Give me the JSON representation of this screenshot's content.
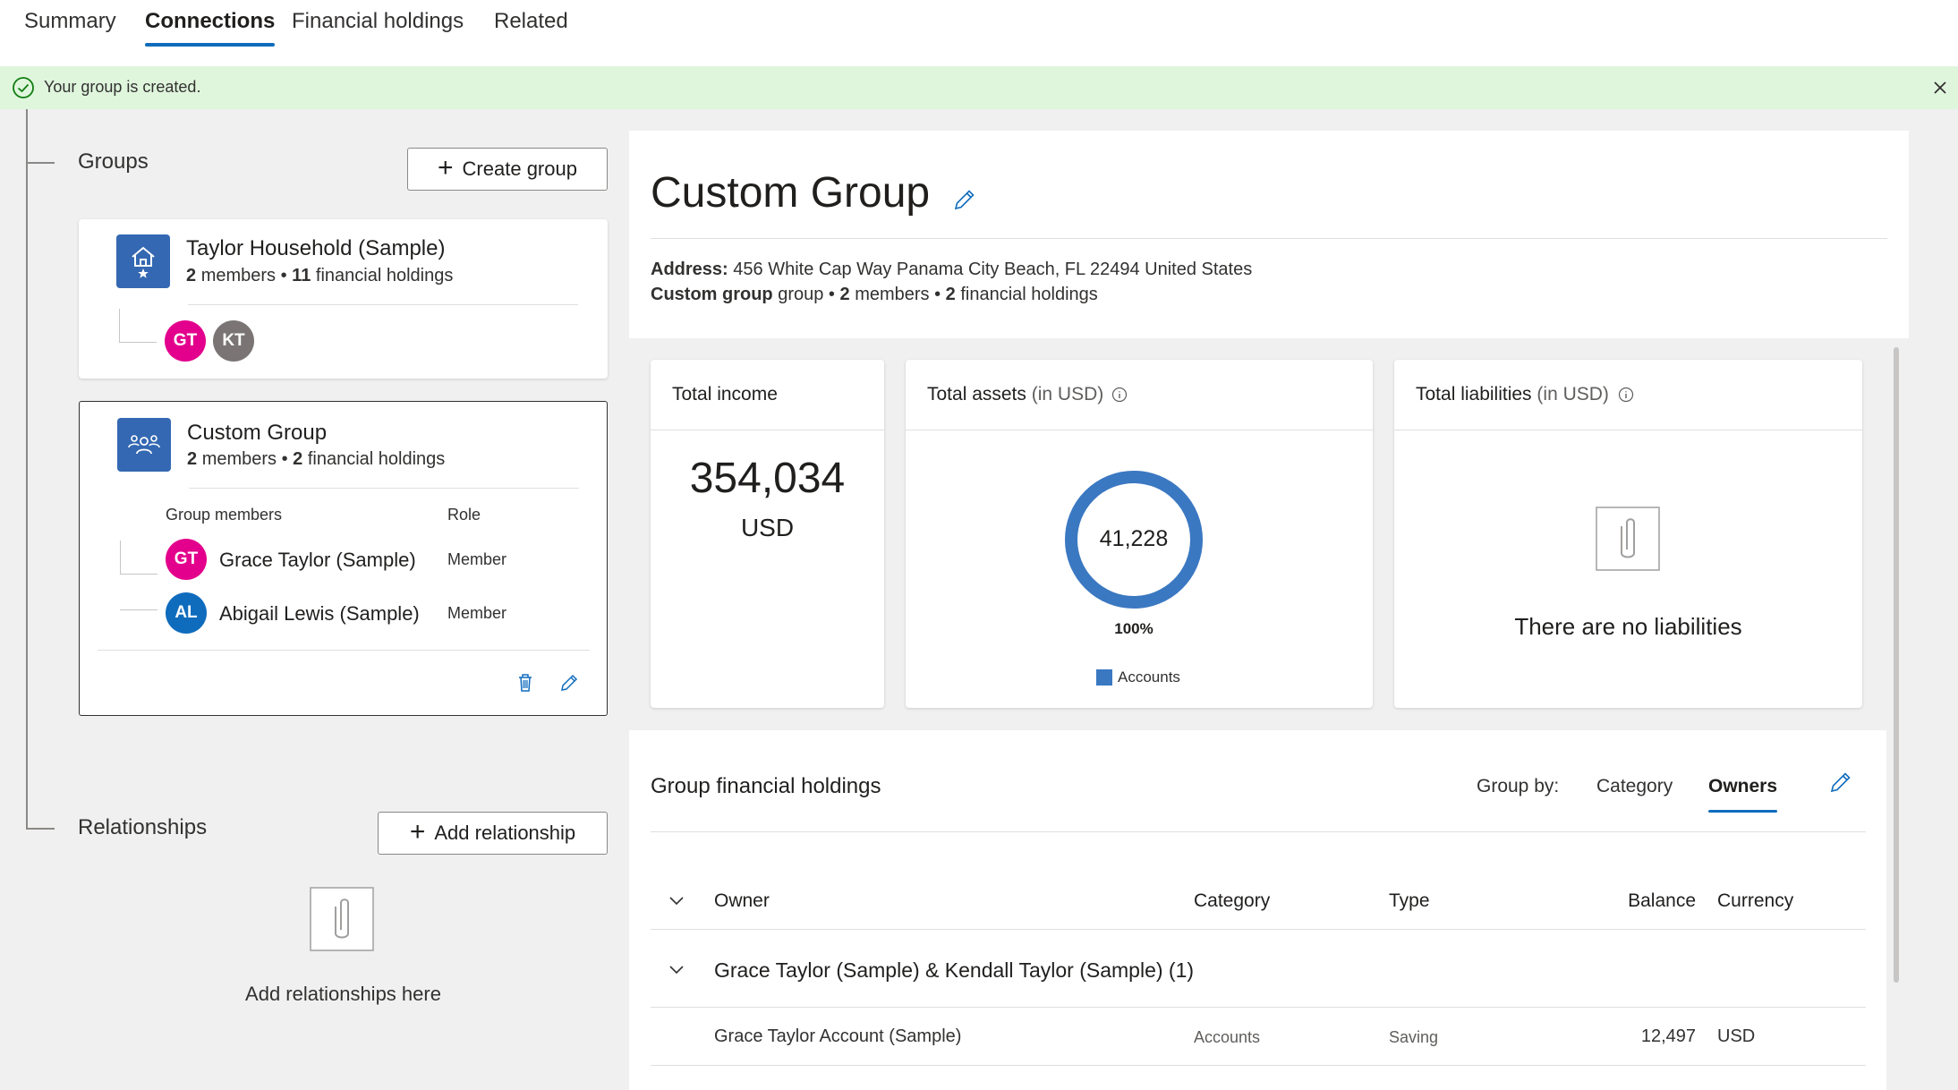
{
  "tabs": [
    {
      "label": "Summary",
      "active": false
    },
    {
      "label": "Connections",
      "active": true
    },
    {
      "label": "Financial holdings",
      "active": false
    },
    {
      "label": "Related",
      "active": false
    }
  ],
  "notification": {
    "text": "Your group is created.",
    "status_color": "#107c10"
  },
  "groups": {
    "title": "Groups",
    "create_label": "Create group",
    "household": {
      "name": "Taylor Household (Sample)",
      "members_count": "2",
      "members_word": "members",
      "holdings_count": "11",
      "holdings_word": "financial holdings",
      "avatars": [
        {
          "initials": "GT",
          "color": "#e3008c"
        },
        {
          "initials": "KT",
          "color": "#7a7574"
        }
      ]
    },
    "custom": {
      "name": "Custom Group",
      "members_count": "2",
      "members_word": "members",
      "holdings_count": "2",
      "holdings_word": "financial holdings",
      "members_header": "Group members",
      "role_header": "Role",
      "members": [
        {
          "initials": "GT",
          "color": "#e3008c",
          "name": "Grace Taylor (Sample)",
          "role": "Member"
        },
        {
          "initials": "AL",
          "color": "#0f6cbd",
          "name": "Abigail Lewis (Sample)",
          "role": "Member"
        }
      ]
    }
  },
  "relationships": {
    "title": "Relationships",
    "add_label": "Add relationship",
    "empty_text": "Add relationships here"
  },
  "detail": {
    "title": "Custom Group",
    "address_label": "Address:",
    "address_value": "456 White Cap Way Panama City Beach, FL 22494 United States",
    "type_bold": "Custom group",
    "type_word": "group",
    "members_count": "2",
    "members_word": "members",
    "holdings_count": "2",
    "holdings_word": "financial holdings"
  },
  "kpis": {
    "income": {
      "title": "Total income",
      "value": "354,034",
      "unit": "USD"
    },
    "assets": {
      "title": "Total assets",
      "unit_hint": "(in USD)",
      "center_value": "41,228",
      "percent": "100%",
      "legend_label": "Accounts",
      "legend_color": "#3a78c2",
      "fill_fraction": 1.0
    },
    "liabilities": {
      "title": "Total liabilities",
      "unit_hint": "(in USD)",
      "empty_text": "There are no liabilities"
    }
  },
  "holdings": {
    "title": "Group financial holdings",
    "group_by_label": "Group by:",
    "group_by_options": [
      {
        "label": "Category",
        "active": false
      },
      {
        "label": "Owners",
        "active": true
      }
    ],
    "columns": {
      "owner": "Owner",
      "category": "Category",
      "type": "Type",
      "balance": "Balance",
      "currency": "Currency"
    },
    "group_row": "Grace Taylor (Sample) & Kendall Taylor (Sample) (1)",
    "rows": [
      {
        "owner": "Grace Taylor Account (Sample)",
        "category": "Accounts",
        "type": "Saving",
        "balance": "12,497",
        "currency": "USD"
      }
    ]
  },
  "colors": {
    "accent": "#0f6cbd",
    "group_icon": "#3468b2",
    "notification_bg": "#dff6dd"
  }
}
